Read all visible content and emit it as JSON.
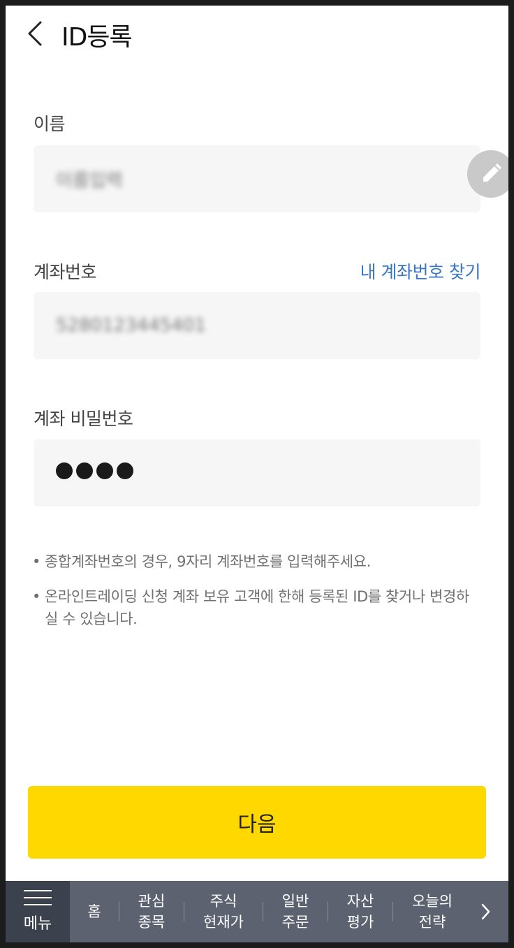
{
  "header": {
    "title": "ID등록"
  },
  "form": {
    "name": {
      "label": "이름",
      "value": "이름입력"
    },
    "account": {
      "label": "계좌번호",
      "find_link": "내 계좌번호 찾기",
      "value": "5280123445401"
    },
    "password": {
      "label": "계좌 비밀번호",
      "dot_count": 4
    }
  },
  "notes": [
    "종합계좌번호의 경우, 9자리 계좌번호를 입력해주세요.",
    "온라인트레이딩 신청 계좌 보유 고객에 한해 등록된 ID를 찾거나 변경하실 수 있습니다."
  ],
  "note_bullet": "•",
  "next_button": "다음",
  "bottom_nav": {
    "menu_label": "메뉴",
    "items": [
      "홈",
      "관심\n종목",
      "주식\n현재가",
      "일반\n주문",
      "자산\n평가",
      "오늘의\n전략"
    ]
  },
  "colors": {
    "accent_yellow": "#ffd800",
    "link_blue": "#3b76c4",
    "nav_bg": "#5c6270",
    "nav_menu_bg": "#3c424d"
  }
}
